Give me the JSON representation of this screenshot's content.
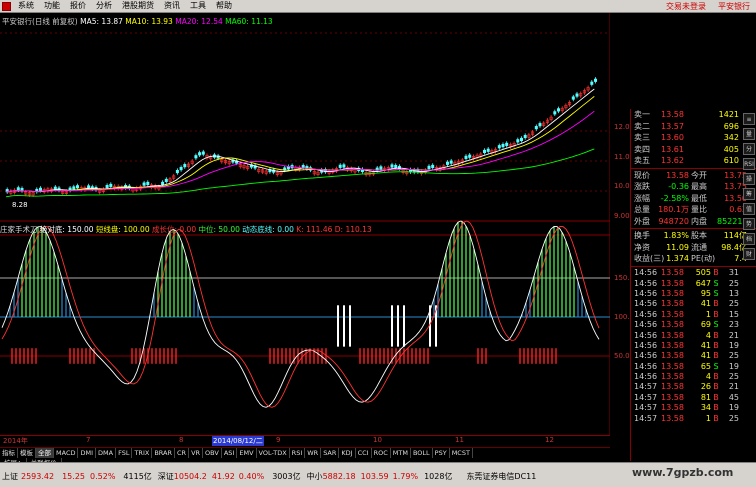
{
  "menu": {
    "items": [
      "系统",
      "功能",
      "报价",
      "分析",
      "港股期货",
      "资讯",
      "工具",
      "帮助"
    ],
    "links": [
      "交易未登录",
      "平安银行"
    ]
  },
  "chart": {
    "title": "平安银行(日线 前复权)",
    "ma5": "MA5: 13.87",
    "ma10": "MA10: 13.93",
    "ma20": "MA20: 12.54",
    "ma60": "MA60: 11.13",
    "low_label": "8.28",
    "y_labels": [
      "12.00",
      "11.00",
      "10.00",
      "9.00"
    ],
    "ind_name": "庄家手术刀",
    "ind_items": [
      "绝对底: 150.00",
      "短线盘: 100.00",
      "成长位: 0.00",
      "中位: 50.00",
      "动态底线: 0.00"
    ],
    "ind_tail": "K: 111.46  D: 110.13",
    "ind_y": [
      "150.00",
      "100.00",
      "50.00"
    ],
    "dates": [
      "2014年",
      "7",
      "8",
      "2014/08/12/二",
      "9",
      "10",
      "11",
      "12"
    ]
  },
  "quote": {
    "sells": [
      {
        "label": "卖一",
        "price": "13.58",
        "vol": "1421"
      },
      {
        "label": "卖二",
        "price": "13.57",
        "vol": "696"
      },
      {
        "label": "卖三",
        "price": "13.60",
        "vol": "342"
      },
      {
        "label": "卖四",
        "price": "13.61",
        "vol": "405"
      },
      {
        "label": "卖五",
        "price": "13.62",
        "vol": "610"
      }
    ],
    "rows1": [
      {
        "a": "现价",
        "b": "13.58",
        "c": "今开",
        "d": "13.75"
      },
      {
        "a": "涨跌",
        "b": "-0.36",
        "c": "最高",
        "d": "13.75"
      },
      {
        "a": "涨幅",
        "b": "-2.58%",
        "c": "最低",
        "d": "13.50"
      },
      {
        "a": "总量",
        "b": "180.1万",
        "c": "量比",
        "d": "0.63"
      },
      {
        "a": "外盘",
        "b": "948720",
        "c": "内盘",
        "d": "852216"
      }
    ],
    "rows2": [
      {
        "a": "换手",
        "b": "1.83%",
        "c": "股本",
        "d": "114亿"
      },
      {
        "a": "净资",
        "b": "11.09",
        "c": "流通",
        "d": "98.4亿"
      },
      {
        "a": "收益(三)",
        "b": "1.374",
        "c": "PE(动)",
        "d": "7.4"
      }
    ],
    "ticks": [
      {
        "t": "14:56",
        "p": "13.58",
        "v": "505",
        "s": "B",
        "n": "31"
      },
      {
        "t": "14:56",
        "p": "13.58",
        "v": "647",
        "s": "S",
        "n": "25"
      },
      {
        "t": "14:56",
        "p": "13.58",
        "v": "95",
        "s": "S",
        "n": "13"
      },
      {
        "t": "14:56",
        "p": "13.58",
        "v": "41",
        "s": "B",
        "n": "25"
      },
      {
        "t": "14:56",
        "p": "13.58",
        "v": "1",
        "s": "B",
        "n": "15"
      },
      {
        "t": "14:56",
        "p": "13.58",
        "v": "69",
        "s": "S",
        "n": "23"
      },
      {
        "t": "14:56",
        "p": "13.58",
        "v": "4",
        "s": "B",
        "n": "21"
      },
      {
        "t": "14:56",
        "p": "13.58",
        "v": "41",
        "s": "B",
        "n": "19"
      },
      {
        "t": "14:56",
        "p": "13.58",
        "v": "41",
        "s": "B",
        "n": "25"
      },
      {
        "t": "14:56",
        "p": "13.58",
        "v": "65",
        "s": "S",
        "n": "19"
      },
      {
        "t": "14:56",
        "p": "13.58",
        "v": "4",
        "s": "B",
        "n": "25"
      },
      {
        "t": "14:57",
        "p": "13.58",
        "v": "26",
        "s": "B",
        "n": "21"
      },
      {
        "t": "14:57",
        "p": "13.58",
        "v": "81",
        "s": "B",
        "n": "45"
      },
      {
        "t": "14:57",
        "p": "13.58",
        "v": "34",
        "s": "B",
        "n": "19"
      },
      {
        "t": "14:57",
        "p": "13.58",
        "v": "1",
        "s": "B",
        "n": "25"
      }
    ]
  },
  "tabs": [
    "指标",
    "模板",
    "全部",
    "MACD",
    "DMI",
    "DMA",
    "FSL",
    "TRIX",
    "BRAR",
    "CR",
    "VR",
    "OBV",
    "ASI",
    "EMV",
    "VOL-TDX",
    "RSI",
    "WR",
    "SAR",
    "KDJ",
    "CCI",
    "ROC",
    "MTM",
    "BOLL",
    "PSY",
    "MCST"
  ],
  "tabs2": [
    "扩展∧",
    "关联报价"
  ],
  "status": {
    "sh_name": "上证",
    "sh_val": "2593.42",
    "sh_chg": "15.25",
    "sh_pct": "0.52%",
    "sh_amt": "4115亿",
    "sz_name": "深证",
    "sz_val": "10504.2",
    "sz_chg": "41.92",
    "sz_pct": "0.40%",
    "sz_amt": "3003亿",
    "zx_name": "中小",
    "zx_val": "5882.18",
    "zx_chg": "103.59",
    "zx_pct": "1.79%",
    "zx_amt": "1028亿",
    "broker": "东莞证券电信DC11"
  },
  "side_tools": [
    "≡",
    "量",
    "分",
    "RSI",
    "操",
    "筹",
    "值",
    "势",
    "档",
    "财"
  ],
  "watermark": "www.7gpzb.com",
  "colors": {
    "up": "#ff3232",
    "down": "#54ffff",
    "ma5": "#ffffff",
    "ma10": "#ffff00",
    "ma20": "#ff00ff",
    "ma60": "#00ff00"
  }
}
